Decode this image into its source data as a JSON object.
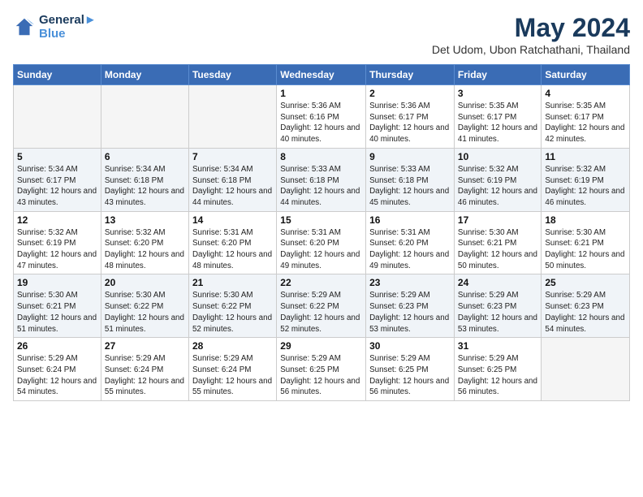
{
  "header": {
    "logo_line1": "General",
    "logo_line2": "Blue",
    "month": "May 2024",
    "location": "Det Udom, Ubon Ratchathani, Thailand"
  },
  "days_of_week": [
    "Sunday",
    "Monday",
    "Tuesday",
    "Wednesday",
    "Thursday",
    "Friday",
    "Saturday"
  ],
  "weeks": [
    [
      {
        "day": "",
        "sunrise": "",
        "sunset": "",
        "daylight": "",
        "empty": true
      },
      {
        "day": "",
        "sunrise": "",
        "sunset": "",
        "daylight": "",
        "empty": true
      },
      {
        "day": "",
        "sunrise": "",
        "sunset": "",
        "daylight": "",
        "empty": true
      },
      {
        "day": "1",
        "sunrise": "Sunrise: 5:36 AM",
        "sunset": "Sunset: 6:16 PM",
        "daylight": "Daylight: 12 hours and 40 minutes."
      },
      {
        "day": "2",
        "sunrise": "Sunrise: 5:36 AM",
        "sunset": "Sunset: 6:17 PM",
        "daylight": "Daylight: 12 hours and 40 minutes."
      },
      {
        "day": "3",
        "sunrise": "Sunrise: 5:35 AM",
        "sunset": "Sunset: 6:17 PM",
        "daylight": "Daylight: 12 hours and 41 minutes."
      },
      {
        "day": "4",
        "sunrise": "Sunrise: 5:35 AM",
        "sunset": "Sunset: 6:17 PM",
        "daylight": "Daylight: 12 hours and 42 minutes."
      }
    ],
    [
      {
        "day": "5",
        "sunrise": "Sunrise: 5:34 AM",
        "sunset": "Sunset: 6:17 PM",
        "daylight": "Daylight: 12 hours and 43 minutes."
      },
      {
        "day": "6",
        "sunrise": "Sunrise: 5:34 AM",
        "sunset": "Sunset: 6:18 PM",
        "daylight": "Daylight: 12 hours and 43 minutes."
      },
      {
        "day": "7",
        "sunrise": "Sunrise: 5:34 AM",
        "sunset": "Sunset: 6:18 PM",
        "daylight": "Daylight: 12 hours and 44 minutes."
      },
      {
        "day": "8",
        "sunrise": "Sunrise: 5:33 AM",
        "sunset": "Sunset: 6:18 PM",
        "daylight": "Daylight: 12 hours and 44 minutes."
      },
      {
        "day": "9",
        "sunrise": "Sunrise: 5:33 AM",
        "sunset": "Sunset: 6:18 PM",
        "daylight": "Daylight: 12 hours and 45 minutes."
      },
      {
        "day": "10",
        "sunrise": "Sunrise: 5:32 AM",
        "sunset": "Sunset: 6:19 PM",
        "daylight": "Daylight: 12 hours and 46 minutes."
      },
      {
        "day": "11",
        "sunrise": "Sunrise: 5:32 AM",
        "sunset": "Sunset: 6:19 PM",
        "daylight": "Daylight: 12 hours and 46 minutes."
      }
    ],
    [
      {
        "day": "12",
        "sunrise": "Sunrise: 5:32 AM",
        "sunset": "Sunset: 6:19 PM",
        "daylight": "Daylight: 12 hours and 47 minutes."
      },
      {
        "day": "13",
        "sunrise": "Sunrise: 5:32 AM",
        "sunset": "Sunset: 6:20 PM",
        "daylight": "Daylight: 12 hours and 48 minutes."
      },
      {
        "day": "14",
        "sunrise": "Sunrise: 5:31 AM",
        "sunset": "Sunset: 6:20 PM",
        "daylight": "Daylight: 12 hours and 48 minutes."
      },
      {
        "day": "15",
        "sunrise": "Sunrise: 5:31 AM",
        "sunset": "Sunset: 6:20 PM",
        "daylight": "Daylight: 12 hours and 49 minutes."
      },
      {
        "day": "16",
        "sunrise": "Sunrise: 5:31 AM",
        "sunset": "Sunset: 6:20 PM",
        "daylight": "Daylight: 12 hours and 49 minutes."
      },
      {
        "day": "17",
        "sunrise": "Sunrise: 5:30 AM",
        "sunset": "Sunset: 6:21 PM",
        "daylight": "Daylight: 12 hours and 50 minutes."
      },
      {
        "day": "18",
        "sunrise": "Sunrise: 5:30 AM",
        "sunset": "Sunset: 6:21 PM",
        "daylight": "Daylight: 12 hours and 50 minutes."
      }
    ],
    [
      {
        "day": "19",
        "sunrise": "Sunrise: 5:30 AM",
        "sunset": "Sunset: 6:21 PM",
        "daylight": "Daylight: 12 hours and 51 minutes."
      },
      {
        "day": "20",
        "sunrise": "Sunrise: 5:30 AM",
        "sunset": "Sunset: 6:22 PM",
        "daylight": "Daylight: 12 hours and 51 minutes."
      },
      {
        "day": "21",
        "sunrise": "Sunrise: 5:30 AM",
        "sunset": "Sunset: 6:22 PM",
        "daylight": "Daylight: 12 hours and 52 minutes."
      },
      {
        "day": "22",
        "sunrise": "Sunrise: 5:29 AM",
        "sunset": "Sunset: 6:22 PM",
        "daylight": "Daylight: 12 hours and 52 minutes."
      },
      {
        "day": "23",
        "sunrise": "Sunrise: 5:29 AM",
        "sunset": "Sunset: 6:23 PM",
        "daylight": "Daylight: 12 hours and 53 minutes."
      },
      {
        "day": "24",
        "sunrise": "Sunrise: 5:29 AM",
        "sunset": "Sunset: 6:23 PM",
        "daylight": "Daylight: 12 hours and 53 minutes."
      },
      {
        "day": "25",
        "sunrise": "Sunrise: 5:29 AM",
        "sunset": "Sunset: 6:23 PM",
        "daylight": "Daylight: 12 hours and 54 minutes."
      }
    ],
    [
      {
        "day": "26",
        "sunrise": "Sunrise: 5:29 AM",
        "sunset": "Sunset: 6:24 PM",
        "daylight": "Daylight: 12 hours and 54 minutes."
      },
      {
        "day": "27",
        "sunrise": "Sunrise: 5:29 AM",
        "sunset": "Sunset: 6:24 PM",
        "daylight": "Daylight: 12 hours and 55 minutes."
      },
      {
        "day": "28",
        "sunrise": "Sunrise: 5:29 AM",
        "sunset": "Sunset: 6:24 PM",
        "daylight": "Daylight: 12 hours and 55 minutes."
      },
      {
        "day": "29",
        "sunrise": "Sunrise: 5:29 AM",
        "sunset": "Sunset: 6:25 PM",
        "daylight": "Daylight: 12 hours and 56 minutes."
      },
      {
        "day": "30",
        "sunrise": "Sunrise: 5:29 AM",
        "sunset": "Sunset: 6:25 PM",
        "daylight": "Daylight: 12 hours and 56 minutes."
      },
      {
        "day": "31",
        "sunrise": "Sunrise: 5:29 AM",
        "sunset": "Sunset: 6:25 PM",
        "daylight": "Daylight: 12 hours and 56 minutes."
      },
      {
        "day": "",
        "sunrise": "",
        "sunset": "",
        "daylight": "",
        "empty": true
      }
    ]
  ]
}
